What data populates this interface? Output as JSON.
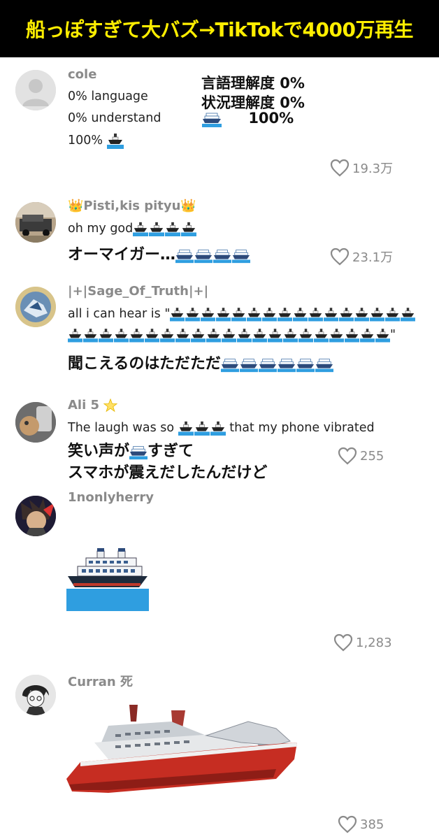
{
  "header": {
    "title": "船っぽすぎて大バズ→TikTokで4000万再生"
  },
  "comments": [
    {
      "username": "cole",
      "lines": [
        "0% language",
        "0% understand",
        "100%"
      ],
      "jp_lines": [
        "言語理解度  0%",
        "状況理解度  0%",
        "100%"
      ],
      "likes": "19.3万"
    },
    {
      "username": "👑Pisti,kis pityu👑",
      "lines": [
        "oh my god"
      ],
      "jp_lines": [
        "オーマイガー…"
      ],
      "likes": "23.1万"
    },
    {
      "username": "|+|Sage_Of_Truth|+|",
      "lines": [
        "all i can hear is \"",
        "\""
      ],
      "jp_lines": [
        "聞こえるのはただただ"
      ],
      "likes": ""
    },
    {
      "username": "Ali 5",
      "lines": [
        "The laugh was so",
        "that my phone vibrated"
      ],
      "jp_lines": [
        "笑い声が",
        "すぎて",
        "スマホが震えだしたんだけど"
      ],
      "likes": "255"
    },
    {
      "username": "1nonlyherry",
      "lines": [],
      "jp_lines": [],
      "likes": "1,283"
    },
    {
      "username": "Curran 死",
      "lines": [],
      "jp_lines": [],
      "likes": "385"
    }
  ],
  "colors": {
    "title_bg": "#000000",
    "title_text": "#ffee00",
    "username": "#8a8a8a",
    "like_text": "#8a8a8a",
    "ship_hull": "#c0392b",
    "water": "#2f9ee0"
  },
  "icons": [
    "heart-outline-icon",
    "ship-emoji-icon",
    "passenger-ship-emoji-icon",
    "star-icon",
    "crown-icon"
  ]
}
